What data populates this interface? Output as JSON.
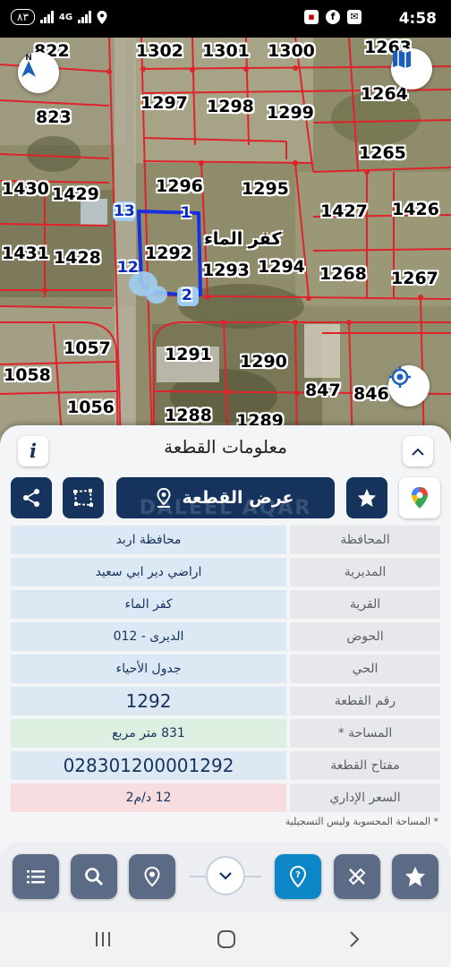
{
  "status_bar": {
    "time": "4:58",
    "battery": "٨٣",
    "network": "4G"
  },
  "map": {
    "plot_labels": [
      {
        "text": "822"
      },
      {
        "text": "1302"
      },
      {
        "text": "1301"
      },
      {
        "text": "1300"
      },
      {
        "text": "1263"
      },
      {
        "text": "823"
      },
      {
        "text": "1297"
      },
      {
        "text": "1298"
      },
      {
        "text": "1299"
      },
      {
        "text": "1264"
      },
      {
        "text": "1265"
      },
      {
        "text": "1430"
      },
      {
        "text": "1429"
      },
      {
        "text": "1296"
      },
      {
        "text": "1295"
      },
      {
        "text": "1427"
      },
      {
        "text": "1426"
      },
      {
        "text": "1431"
      },
      {
        "text": "1428"
      },
      {
        "text": "1292"
      },
      {
        "text": "1293"
      },
      {
        "text": "1294"
      },
      {
        "text": "1268"
      },
      {
        "text": "1267"
      },
      {
        "text": "1057"
      },
      {
        "text": "1291"
      },
      {
        "text": "1290"
      },
      {
        "text": "1058"
      },
      {
        "text": "847"
      },
      {
        "text": "846"
      },
      {
        "text": "1056"
      },
      {
        "text": "1288"
      },
      {
        "text": "1289"
      }
    ],
    "vertices": [
      "13",
      "1",
      "12",
      "2"
    ],
    "village_label": "كفر الماء",
    "compass_label": "N"
  },
  "sheet": {
    "title": "معلومات القطعة",
    "info_icon": "i",
    "show_plot_button": "عرض القطعة",
    "watermark": "DALEEL AQAR",
    "rows": [
      {
        "label": "المحافظة",
        "value": "محافظة اربد"
      },
      {
        "label": "المديرية",
        "value": "اراضي دير ابي سعيد"
      },
      {
        "label": "القرية",
        "value": "كفر الماء"
      },
      {
        "label": "الحوض",
        "value": "الديرى - 012"
      },
      {
        "label": "الحي",
        "value": "جدول الأحياء"
      },
      {
        "label": "رقم القطعة",
        "value": "1292"
      },
      {
        "label": "المساحة *",
        "value": "831  متر مربع"
      },
      {
        "label": "مفتاح القطعة",
        "value": "028301200001292"
      },
      {
        "label": "السعر الإداري",
        "value": "12 د/م2"
      }
    ],
    "note": "* المساحة المحسوبة وليس التسجيلية"
  },
  "colors": {
    "navy": "#16335e",
    "active_blue": "#0c86c7",
    "parcel_line": "#e0232b",
    "highlight": "#1a2fe0"
  }
}
